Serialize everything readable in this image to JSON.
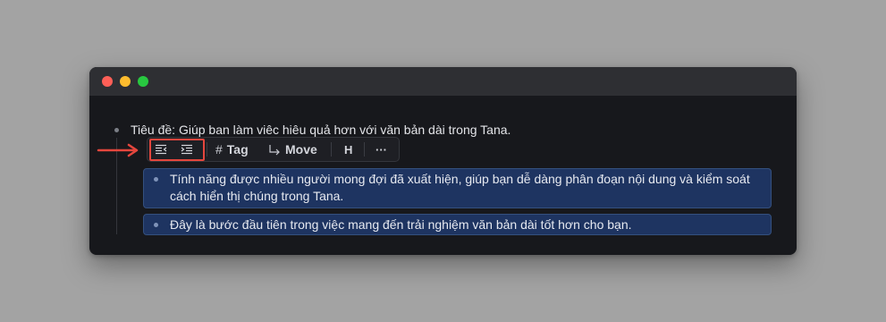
{
  "window": {
    "traffic_lights": {
      "close": "#fe5f57",
      "minimize": "#febc2e",
      "maximize": "#28c840"
    }
  },
  "outline": {
    "parent_node": "Tiêu đề: Giúp ban làm viêc hiêu quả hơn với văn bản dài trong Tana.",
    "children": [
      "Tính năng được nhiều người mong đợi đã xuất hiện, giúp bạn dễ dàng phân đoạn nội dung và kiểm soát cách hiển thị chúng trong Tana.",
      "Đây là bước đầu tiên trong việc mang đến trải nghiệm văn bản dài tốt hơn cho bạn."
    ]
  },
  "toolbar": {
    "outdent_icon": "outdent-icon",
    "indent_icon": "indent-icon",
    "tag_symbol": "#",
    "tag_label": "Tag",
    "move_icon": "move-arrow-icon",
    "move_label": "Move",
    "heading_label": "H",
    "more_label": "···"
  },
  "annotation": {
    "arrow_color": "#e5463d",
    "highlight_color": "#e5463d"
  },
  "colors": {
    "selection_bg": "#1e3461",
    "background": "#a3a3a3",
    "window_bg": "#17181c"
  }
}
